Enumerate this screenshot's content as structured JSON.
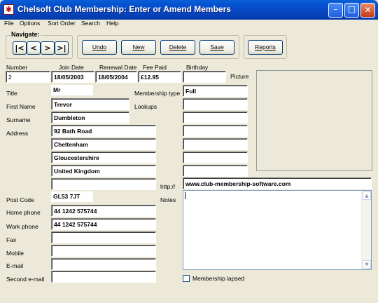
{
  "window": {
    "title": "Chelsoft Club Membership: Enter or Amend Members",
    "app_icon_glyph": "✱",
    "minimize_glyph": "_",
    "maximize_glyph": "□",
    "close_glyph": "✕"
  },
  "menu": {
    "file": "File",
    "options": "Options",
    "sort_order": "Sort Order",
    "search": "Search",
    "help": "Help"
  },
  "navigate": {
    "legend": "Navigate:",
    "first": "|<",
    "prev": "<",
    "next": ">",
    "last": ">|"
  },
  "toolbar": {
    "undo": "Undo",
    "new": "New",
    "delete": "Delete",
    "save": "Save",
    "reports": "Reports"
  },
  "headers": {
    "number": "Number",
    "join_date": "Join Date",
    "renewal_date": "Renewal Date",
    "fee_paid": "Fee Paid",
    "birthday": "Birthday",
    "picture": "Picture"
  },
  "values": {
    "number": "2",
    "join_date": "18/05/2003",
    "renewal_date": "18/05/2004",
    "fee_paid": "£12.95",
    "birthday": "",
    "title": "Mr",
    "first_name": "Trevor",
    "surname": "Dumbleton",
    "address": [
      "92 Bath Road",
      "Cheltenham",
      "Gloucestershire",
      "United Kingdom",
      ""
    ],
    "post_code": "GL53 7JT",
    "home_phone": "44 1242 575744",
    "work_phone": "44 1242 575744",
    "fax": "",
    "mobile": "",
    "email": "",
    "second_email": "",
    "membership_type": "Full",
    "website": "www.club-membership-software.com",
    "notes": ""
  },
  "labels": {
    "title": "Title",
    "first_name": "First Name",
    "surname": "Surname",
    "address": "Address",
    "post_code": "Post Code",
    "home_phone": "Home phone",
    "work_phone": "Work phone",
    "fax": "Fax",
    "mobile": "Mobile",
    "email": "E-mail",
    "second_email": "Second e-mail",
    "membership_type": "Membership type",
    "lookups": "Lookups",
    "http": "http://",
    "notes": "Notes",
    "membership_lapsed": "Membership lapsed"
  },
  "colors": {
    "title_bar": "#0453d0",
    "window_bg": "#ece9d8",
    "close_button": "#c63a12"
  }
}
